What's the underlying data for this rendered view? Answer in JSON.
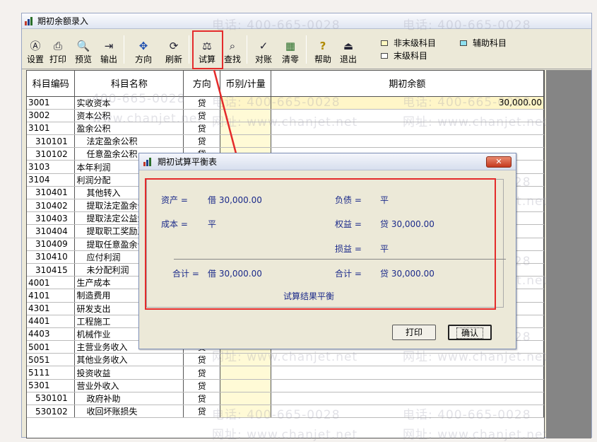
{
  "window": {
    "title": "期初余额录入"
  },
  "toolbar": {
    "buttons": [
      {
        "label": "设置",
        "icon": "settings-icon",
        "glyph": "Ⓐ"
      },
      {
        "label": "打印",
        "icon": "printer-icon",
        "glyph": "⎙"
      },
      {
        "label": "预览",
        "icon": "preview-icon",
        "glyph": "🔍"
      },
      {
        "label": "输出",
        "icon": "export-icon",
        "glyph": "⇥"
      },
      {
        "label": "方向",
        "icon": "direction-icon",
        "glyph": "✥"
      },
      {
        "label": "刷新",
        "icon": "refresh-icon",
        "glyph": "⟳"
      },
      {
        "label": "试算",
        "icon": "balance-scale-icon",
        "glyph": "⚖"
      },
      {
        "label": "查找",
        "icon": "find-icon",
        "glyph": "⌕"
      },
      {
        "label": "对账",
        "icon": "reconcile-icon",
        "glyph": "✓"
      },
      {
        "label": "清零",
        "icon": "clear-icon",
        "glyph": "▦"
      },
      {
        "label": "帮助",
        "icon": "help-icon",
        "glyph": "?"
      },
      {
        "label": "退出",
        "icon": "exit-icon",
        "glyph": "⏏"
      }
    ],
    "legend": {
      "non_leaf": "非末级科目",
      "auxiliary": "辅助科目",
      "leaf": "末级科目"
    }
  },
  "table": {
    "headers": [
      "科目编码",
      "科目名称",
      "方向",
      "币别/计量",
      "期初余额"
    ],
    "rows": [
      {
        "code": "3001",
        "name": "实收资本",
        "dir": "贷",
        "amount": "30,000.00",
        "sub": false
      },
      {
        "code": "3002",
        "name": "资本公积",
        "dir": "贷",
        "amount": "",
        "sub": false
      },
      {
        "code": "3101",
        "name": "盈余公积",
        "dir": "贷",
        "amount": "",
        "sub": false
      },
      {
        "code": "310101",
        "name": "法定盈余公积",
        "dir": "贷",
        "amount": "",
        "sub": true
      },
      {
        "code": "310102",
        "name": "任意盈余公积",
        "dir": "贷",
        "amount": "",
        "sub": true
      },
      {
        "code": "3103",
        "name": "本年利润",
        "dir": "贷",
        "amount": "",
        "sub": false
      },
      {
        "code": "3104",
        "name": "利润分配",
        "dir": "贷",
        "amount": "",
        "sub": false
      },
      {
        "code": "310401",
        "name": "其他转入",
        "dir": "贷",
        "amount": "",
        "sub": true
      },
      {
        "code": "310402",
        "name": "提取法定盈余公积",
        "dir": "贷",
        "amount": "",
        "sub": true
      },
      {
        "code": "310403",
        "name": "提取法定公益金",
        "dir": "贷",
        "amount": "",
        "sub": true
      },
      {
        "code": "310404",
        "name": "提取职工奖励及福利基金",
        "dir": "贷",
        "amount": "",
        "sub": true
      },
      {
        "code": "310409",
        "name": "提取任意盈余公积",
        "dir": "贷",
        "amount": "",
        "sub": true
      },
      {
        "code": "310410",
        "name": "应付利润",
        "dir": "贷",
        "amount": "",
        "sub": true
      },
      {
        "code": "310415",
        "name": "未分配利润",
        "dir": "贷",
        "amount": "",
        "sub": true
      },
      {
        "code": "4001",
        "name": "生产成本",
        "dir": "借",
        "amount": "",
        "sub": false
      },
      {
        "code": "4101",
        "name": "制造费用",
        "dir": "借",
        "amount": "",
        "sub": false
      },
      {
        "code": "4301",
        "name": "研发支出",
        "dir": "借",
        "amount": "",
        "sub": false
      },
      {
        "code": "4401",
        "name": "工程施工",
        "dir": "借",
        "amount": "",
        "sub": false
      },
      {
        "code": "4403",
        "name": "机械作业",
        "dir": "借",
        "amount": "",
        "sub": false
      },
      {
        "code": "5001",
        "name": "主营业务收入",
        "dir": "贷",
        "amount": "",
        "sub": false
      },
      {
        "code": "5051",
        "name": "其他业务收入",
        "dir": "贷",
        "amount": "",
        "sub": false
      },
      {
        "code": "5111",
        "name": "投资收益",
        "dir": "贷",
        "amount": "",
        "sub": false
      },
      {
        "code": "5301",
        "name": "营业外收入",
        "dir": "贷",
        "amount": "",
        "sub": false
      },
      {
        "code": "530101",
        "name": "政府补助",
        "dir": "贷",
        "amount": "",
        "sub": true
      },
      {
        "code": "530102",
        "name": "收回坏账损失",
        "dir": "贷",
        "amount": "",
        "sub": true
      }
    ]
  },
  "dialog": {
    "title": "期初试算平衡表",
    "close_label": "✕",
    "assets_label": "资产 =",
    "assets_value": "借 30,000.00",
    "liabilities_label": "负债 =",
    "liabilities_value": "平",
    "cost_label": "成本 =",
    "cost_value": "平",
    "equity_label": "权益 =",
    "equity_value": "贷 30,000.00",
    "pl_label": "损益 =",
    "pl_value": "平",
    "total_left_label": "合计 =",
    "total_left_value": "借 30,000.00",
    "total_right_label": "合计 =",
    "total_right_value": "贷 30,000.00",
    "result": "试算结果平衡",
    "print_label": "打印",
    "confirm_label": "确认"
  },
  "watermark": {
    "phone": "电话: 400-665-0028",
    "site": "网址: www.chanjet.net",
    "phone_short": "400-665-0028",
    "site_short": "www.chanjet.net"
  },
  "colors": {
    "highlight_red": "#e42b2b",
    "dialog_text": "#1b2a8a",
    "currency_cell": "#fffad6"
  }
}
